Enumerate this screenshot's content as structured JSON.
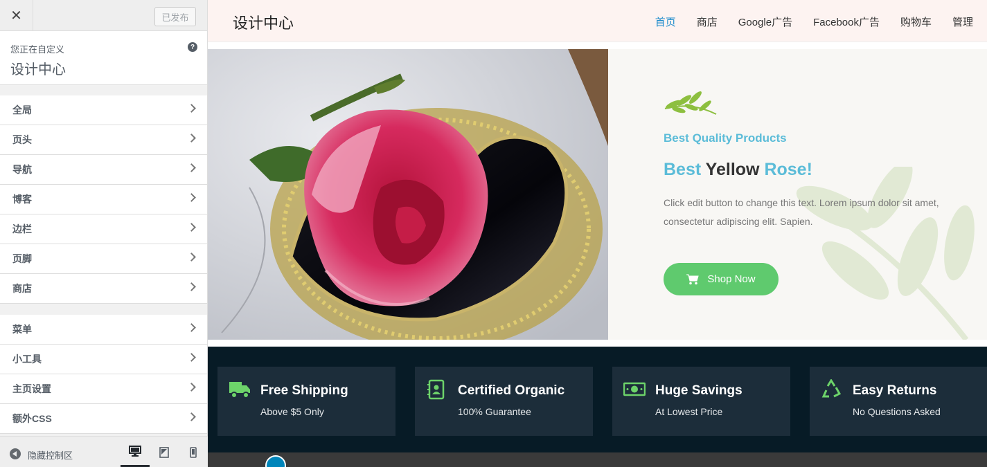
{
  "sidebar": {
    "close_icon": "close-icon",
    "publish_label": "已发布",
    "customizing_label": "您正在自定义",
    "site_name": "设计中心",
    "help_icon": "?",
    "sections_a": [
      {
        "label": "全局"
      },
      {
        "label": "页头"
      },
      {
        "label": "导航"
      },
      {
        "label": "博客"
      },
      {
        "label": "边栏"
      },
      {
        "label": "页脚"
      },
      {
        "label": "商店"
      }
    ],
    "sections_b": [
      {
        "label": "菜单"
      },
      {
        "label": "小工具"
      },
      {
        "label": "主页设置"
      },
      {
        "label": "额外CSS"
      }
    ],
    "footer": {
      "collapse_label": "隐藏控制区",
      "active_device": "desktop"
    }
  },
  "site": {
    "title": "设计中心",
    "nav": [
      {
        "label": "首页",
        "active": true
      },
      {
        "label": "商店"
      },
      {
        "label": "Google广告"
      },
      {
        "label": "Facebook广告"
      },
      {
        "label": "购物车"
      },
      {
        "label": "管理"
      }
    ]
  },
  "hero": {
    "tagline": "Best Quality Products",
    "headline_1": "Best",
    "headline_2": " Yellow ",
    "headline_3": "Rose!",
    "description": "Click edit button to change this text. Lorem ipsum dolor sit amet, consectetur adipiscing elit. Sapien.",
    "button_label": "Shop Now"
  },
  "features": [
    {
      "icon": "truck-icon",
      "title": "Free Shipping",
      "subtitle": "Above $5 Only"
    },
    {
      "icon": "certificate-icon",
      "title": "Certified Organic",
      "subtitle": "100% Guarantee"
    },
    {
      "icon": "money-bill-icon",
      "title": "Huge Savings",
      "subtitle": "At Lowest Price"
    },
    {
      "icon": "recycle-icon",
      "title": "Easy Returns",
      "subtitle": "No Questions Asked"
    }
  ],
  "colors": {
    "accent_blue": "#5bbcd8",
    "button_green": "#5fca6e",
    "feature_bg": "#071b26",
    "feature_card": "#1c2d3a",
    "icon_green": "#6dd36a",
    "nav_active": "#1a8acb"
  }
}
